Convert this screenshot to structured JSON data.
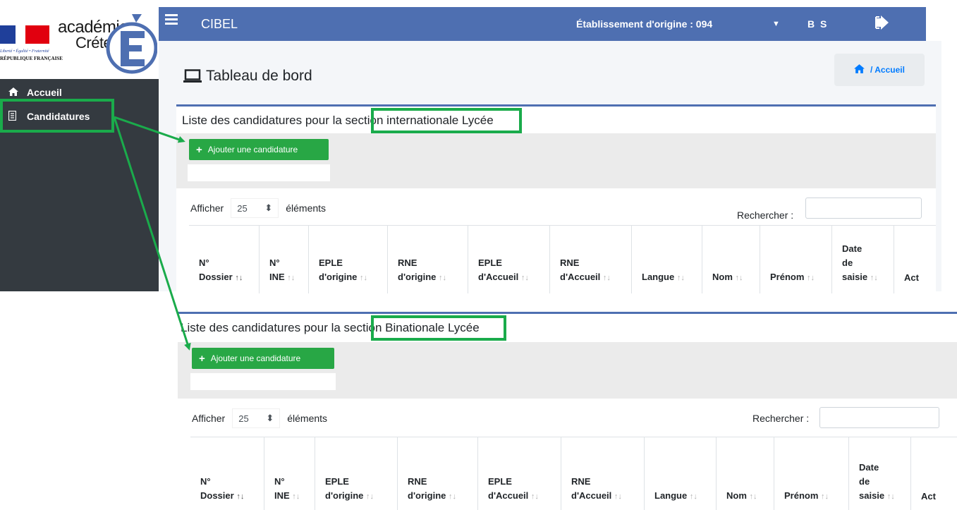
{
  "logo": {
    "academie": "académie",
    "city": "Créteil",
    "motto": "Liberté • Égalité • Fraternité",
    "republic": "RÉPUBLIQUE FRANÇAISE",
    "big_letter": "É"
  },
  "sidebar": {
    "items": [
      {
        "label": "Accueil",
        "icon": "home-icon"
      },
      {
        "label": "Candidatures",
        "icon": "document-icon"
      }
    ]
  },
  "topbar": {
    "title": "CIBEL",
    "etablissement": "Établissement d'origine : 094",
    "user": "B S",
    "color": "#4e6fb1"
  },
  "page": {
    "title": "Tableau de bord",
    "breadcrumb": "/ Accueil"
  },
  "cards": [
    {
      "title": "Liste des candidatures pour la section internationale Lycée",
      "add_label": "Ajouter une candidature",
      "show_prefix": "Afficher",
      "show_value": "25",
      "show_suffix": "éléments",
      "search_label": "Rechercher :"
    },
    {
      "title": "Liste des candidatures pour la section Binationale Lycée",
      "add_label": "Ajouter une candidature",
      "show_prefix": "Afficher",
      "show_value": "25",
      "show_suffix": "éléments",
      "search_label": "Rechercher :"
    }
  ],
  "table": {
    "columns": [
      "N°\nDossier",
      "N°\nINE",
      "EPLE\nd'origine",
      "RNE\nd'origine",
      "EPLE\nd'Accueil",
      "RNE\nd'Accueil",
      "Langue",
      "Nom",
      "Prénom",
      "Date\nde\nsaisie",
      "Act"
    ]
  },
  "accent_colors": {
    "highlight": "#1aab4b",
    "button": "#28a745"
  }
}
